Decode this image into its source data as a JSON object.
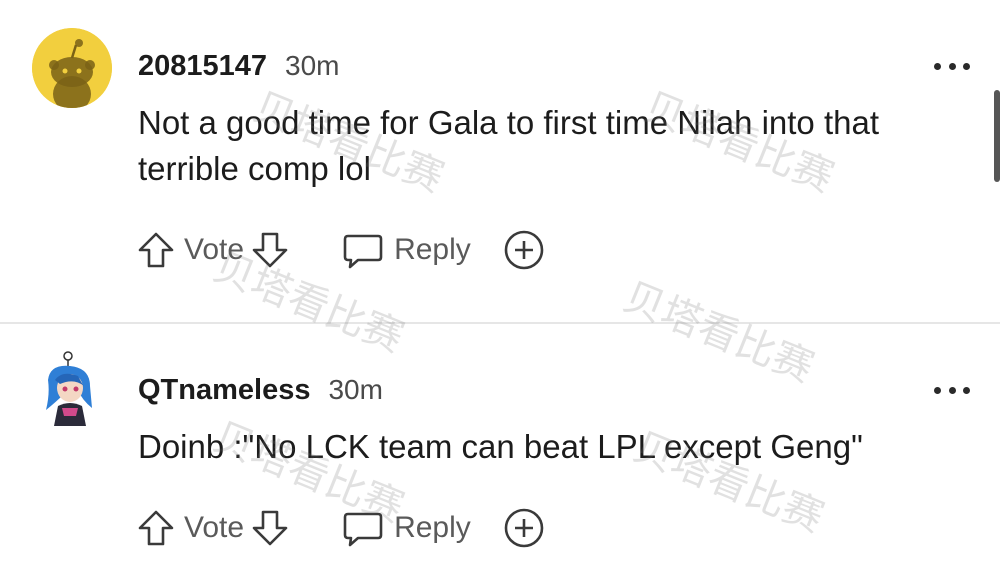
{
  "comments": [
    {
      "username": "20815147",
      "time": "30m",
      "text": "Not a good time for Gala to first time Nilah into that terrible comp lol",
      "vote_label": "Vote",
      "reply_label": "Reply"
    },
    {
      "username": "QTnameless",
      "time": "30m",
      "text": "Doinb :\"No LCK team can beat LPL except Geng\"",
      "vote_label": "Vote",
      "reply_label": "Reply"
    }
  ],
  "watermark": "贝塔看比赛",
  "icons": {
    "upvote": "arrow-up-icon",
    "downvote": "arrow-down-icon",
    "reply": "speech-bubble-icon",
    "award": "plus-circle-icon",
    "more": "ellipsis-icon"
  },
  "colors": {
    "avatar_yellow": "#f2cf3e",
    "text": "#1c1c1c",
    "muted": "#5a5a5a",
    "divider": "#e6e6e6"
  }
}
